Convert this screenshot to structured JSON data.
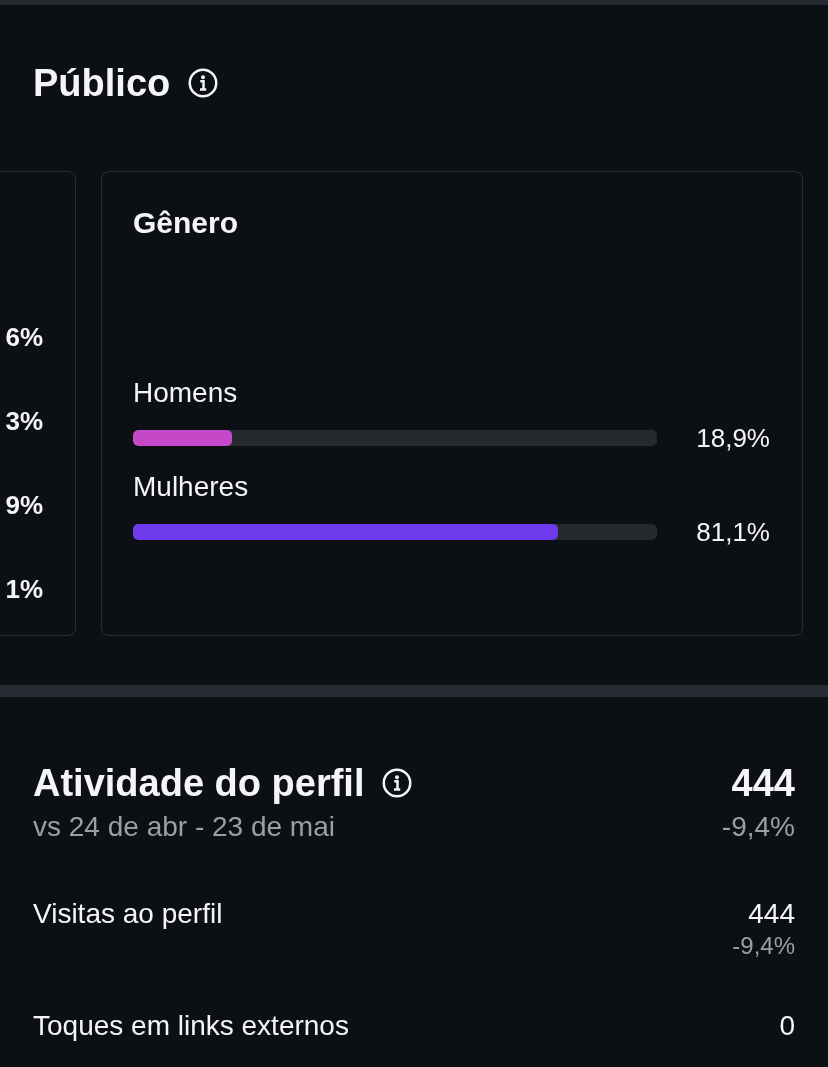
{
  "audience": {
    "title": "Público",
    "partial_card": {
      "values": [
        "6%",
        "3%",
        "9%",
        "1%"
      ]
    },
    "gender_card": {
      "title": "Gênero",
      "bars": [
        {
          "label": "Homens",
          "level": 0.189,
          "reading": "18,9%",
          "color": "#c548c8"
        },
        {
          "label": "Mulheres",
          "level": 0.811,
          "reading": "81,1%",
          "color": "#6d3beb"
        }
      ]
    }
  },
  "profile_activity": {
    "title": "Atividade do perfil",
    "total": "444",
    "comparison": "vs 24 de abr - 23 de mai",
    "change": "-9,4%",
    "rows": [
      {
        "label": "Visitas ao perfil",
        "value": "444",
        "change": "-9,4%"
      },
      {
        "label": "Toques em links externos",
        "value": "0"
      }
    ]
  }
}
